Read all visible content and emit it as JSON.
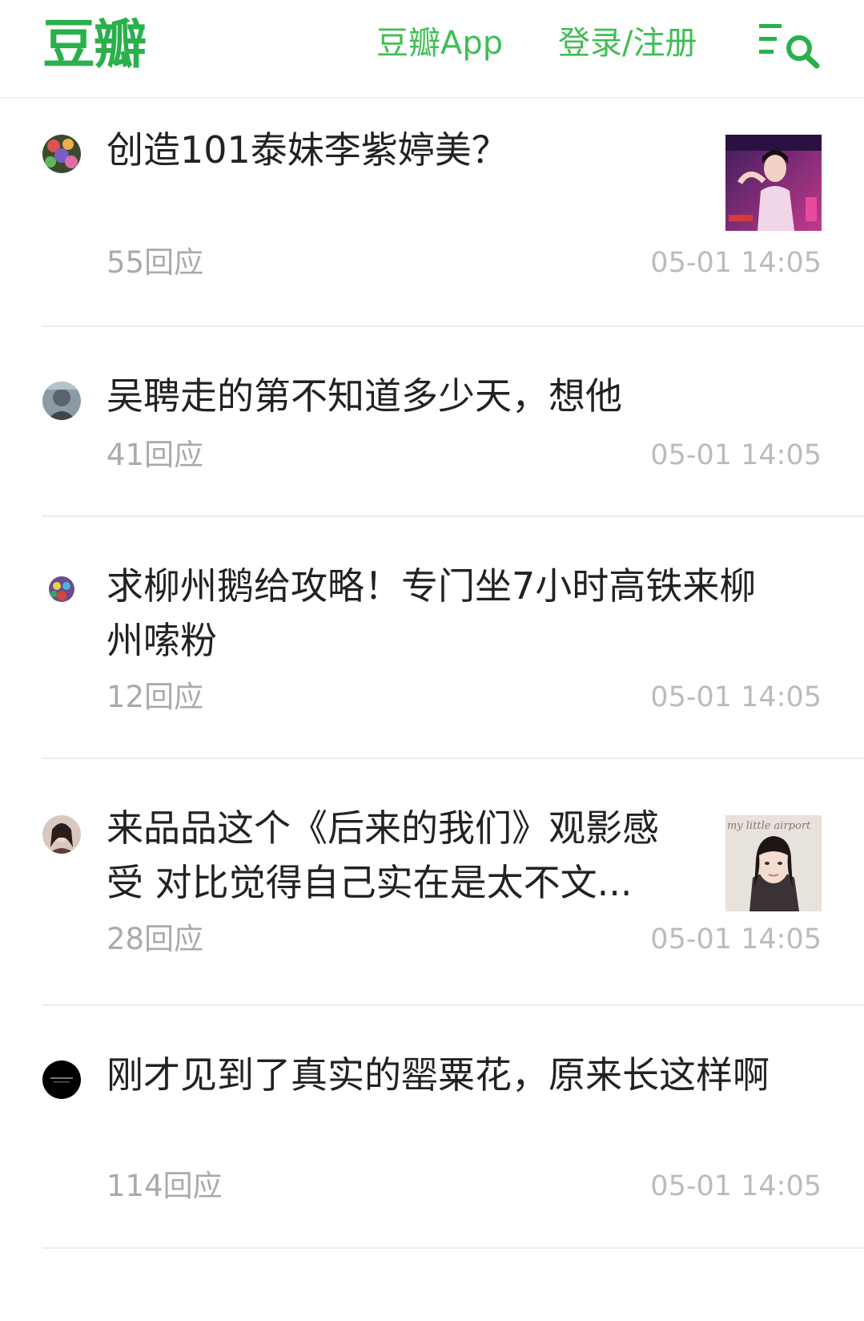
{
  "header": {
    "logo": "豆瓣",
    "app_link": "豆瓣App",
    "login_link": "登录/注册",
    "menu_icon": "menu-search-icon",
    "accent_color": "#42bd56"
  },
  "posts": [
    {
      "title": "创造101泰妹李紫婷美？",
      "replies": "55回应",
      "time": "05-01 14:05",
      "has_thumb": true
    },
    {
      "title": "吴聘走的第不知道多少天，想他",
      "replies": "41回应",
      "time": "05-01 14:05",
      "has_thumb": false
    },
    {
      "title": "求柳州鹅给攻略！专门坐7小时高铁来柳州嗦粉",
      "replies": "12回应",
      "time": "05-01 14:05",
      "has_thumb": false
    },
    {
      "title": "来品品这个《后来的我们》观影感受 对比觉得自己实在是太不文...",
      "replies": "28回应",
      "time": "05-01 14:05",
      "has_thumb": true,
      "thumb_text": "my little airport"
    },
    {
      "title": "刚才见到了真实的罂粟花，原来长这样啊",
      "replies": "114回应",
      "time": "05-01 14:05",
      "has_thumb": false
    }
  ]
}
